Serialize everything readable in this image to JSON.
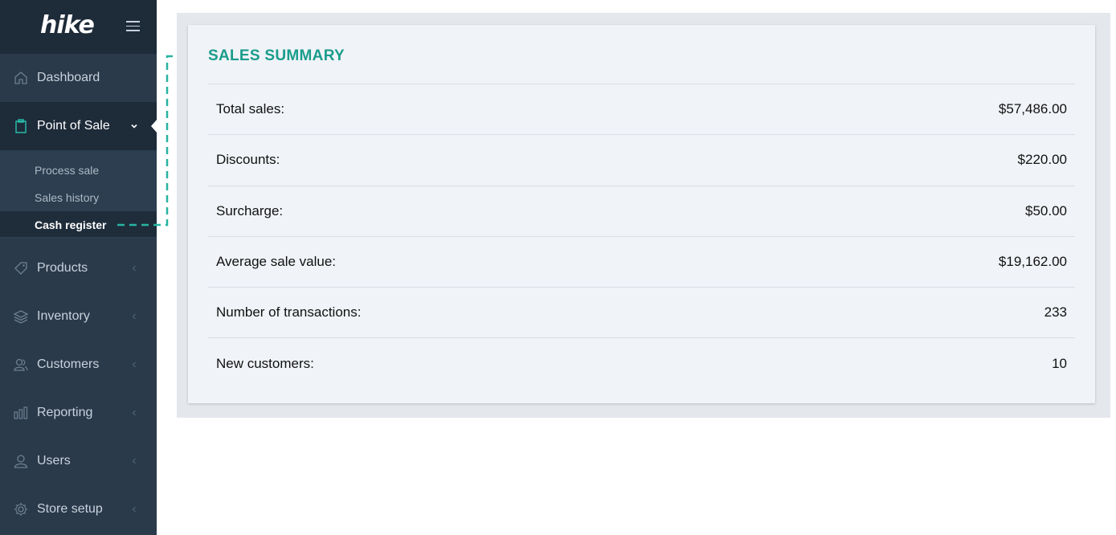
{
  "app": {
    "logo": "hike"
  },
  "sidebar": {
    "items": [
      {
        "label": "Dashboard",
        "icon": "home-icon"
      },
      {
        "label": "Point of Sale",
        "icon": "clipboard-icon"
      },
      {
        "label": "Products",
        "icon": "tag-icon"
      },
      {
        "label": "Inventory",
        "icon": "layers-icon"
      },
      {
        "label": "Customers",
        "icon": "users-icon"
      },
      {
        "label": "Reporting",
        "icon": "bar-chart-icon"
      },
      {
        "label": "Users",
        "icon": "user-icon"
      },
      {
        "label": "Store setup",
        "icon": "gear-icon"
      }
    ],
    "submenu": [
      {
        "label": "Process sale"
      },
      {
        "label": "Sales history"
      },
      {
        "label": "Cash register"
      }
    ]
  },
  "summary": {
    "title": "SALES SUMMARY",
    "rows": [
      {
        "label": "Total sales:",
        "value": "$57,486.00"
      },
      {
        "label": "Discounts:",
        "value": "$220.00"
      },
      {
        "label": "Surcharge:",
        "value": "$50.00"
      },
      {
        "label": "Average sale value:",
        "value": "$19,162.00"
      },
      {
        "label": "Number of transactions:",
        "value": "233"
      },
      {
        "label": "New customers:",
        "value": "10"
      }
    ]
  },
  "colors": {
    "accent": "#1a9c8c",
    "sidebar": "#2a3a4b",
    "sidebar_dark": "#1e2b39"
  }
}
